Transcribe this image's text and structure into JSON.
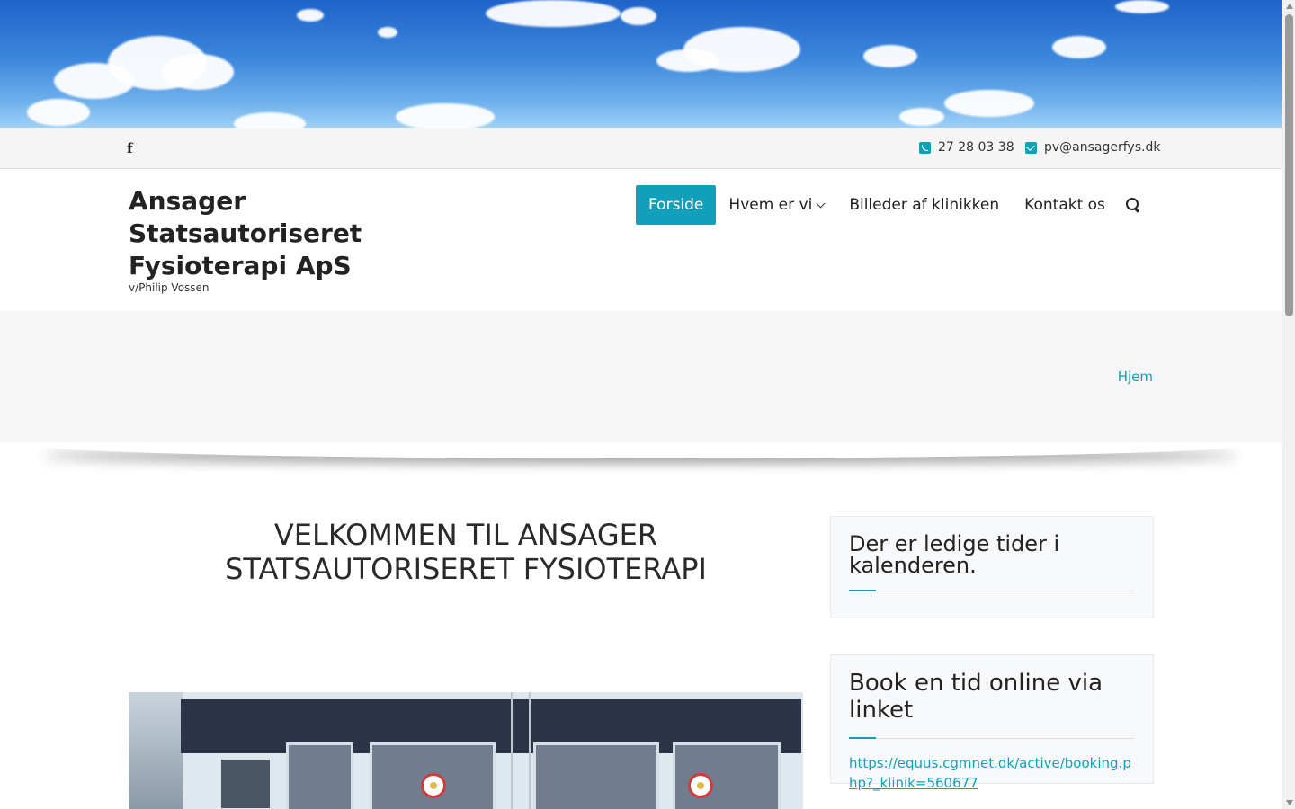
{
  "topbar": {
    "facebook_icon": "facebook-icon",
    "phone": "27 28 03 38",
    "email": "pv@ansagerfys.dk"
  },
  "brand": {
    "name": "Ansager Statsautoriseret Fysioterapi ApS",
    "tagline": "v/Philip Vossen"
  },
  "nav": {
    "items": [
      {
        "label": "Forside",
        "active": true
      },
      {
        "label": "Hvem er vi",
        "has_dropdown": true
      },
      {
        "label": "Billeder af klinikken"
      },
      {
        "label": "Kontakt os"
      }
    ],
    "search_icon": "search-icon"
  },
  "breadcrumb": {
    "home": "Hjem"
  },
  "main": {
    "title": "VELKOMMEN TIL ANSAGER STATSAUTORISERET FYSIOTERAPI"
  },
  "sidebar": {
    "widget1_title": "Der er ledige tider i kalenderen.",
    "widget2_title": "Book en tid online via linket",
    "widget2_link": "https://equus.cgmnet.dk/active/booking.php?_klinik=560677"
  },
  "colors": {
    "accent": "#11a0ba",
    "topbar_bg": "#f5f5f5",
    "band_bg": "#f6f6f6"
  }
}
